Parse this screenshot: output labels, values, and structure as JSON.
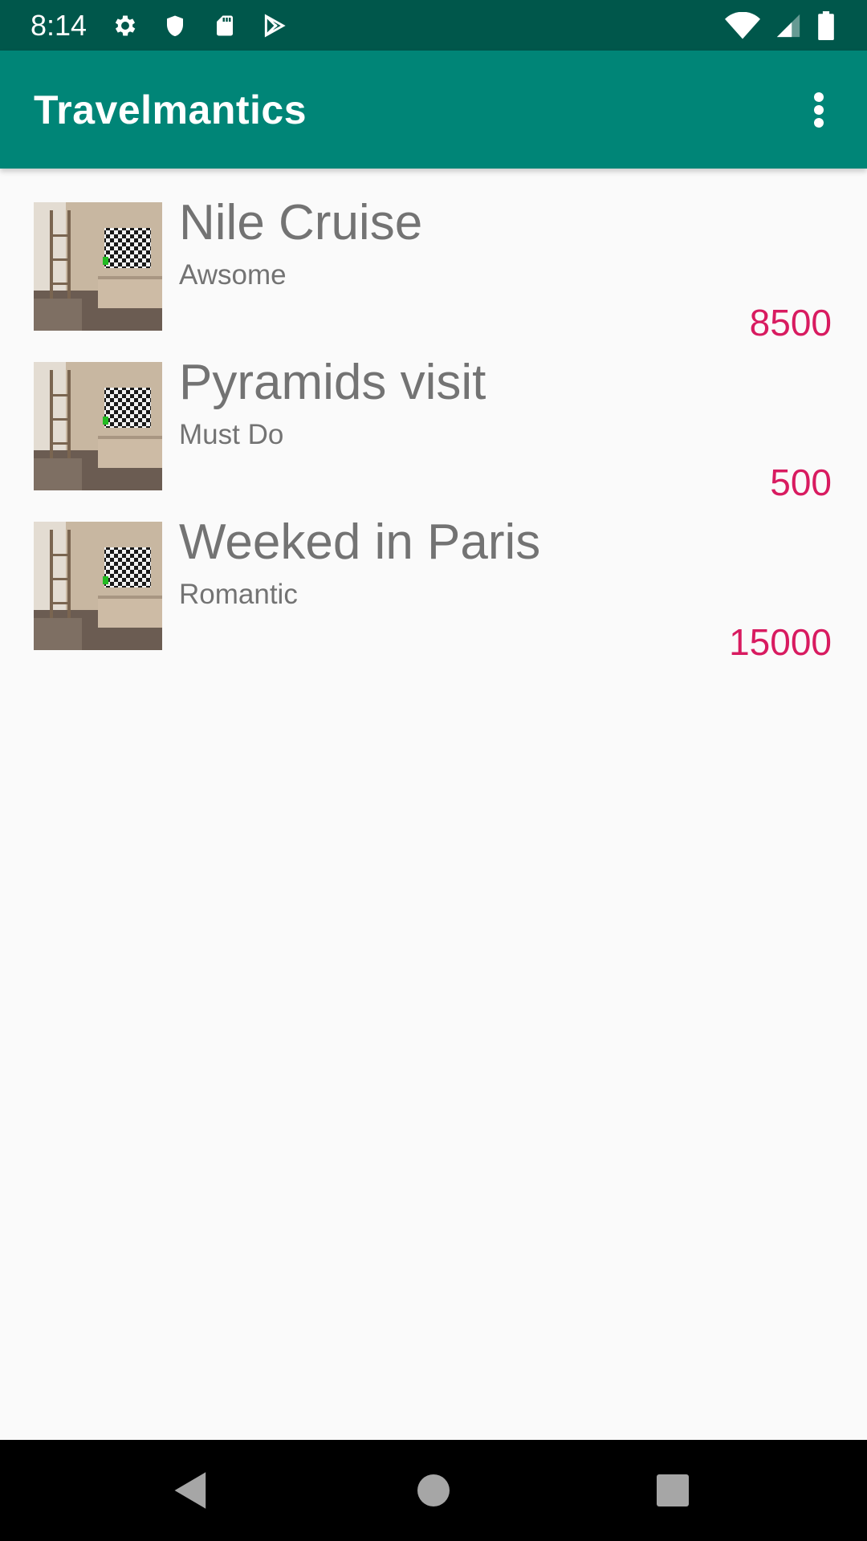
{
  "status_bar": {
    "time": "8:14",
    "left_icons": [
      "gear-icon",
      "shield-icon",
      "sd-card-icon",
      "play-store-icon"
    ],
    "right_icons": [
      "wifi-icon",
      "signal-icon",
      "battery-icon"
    ]
  },
  "app_bar": {
    "title": "Travelmantics",
    "menu_icon": "more-vert-icon"
  },
  "deals": [
    {
      "title": "Nile Cruise",
      "description": "Awsome",
      "price": "8500"
    },
    {
      "title": "Pyramids visit",
      "description": "Must Do",
      "price": "500"
    },
    {
      "title": "Weeked in Paris",
      "description": "Romantic",
      "price": "15000"
    }
  ],
  "nav_bar": {
    "buttons": [
      "back-icon",
      "home-icon",
      "recents-icon"
    ]
  },
  "colors": {
    "status_bar": "#00574b",
    "app_bar": "#008577",
    "accent": "#d81b60",
    "text": "#737373",
    "background": "#fafafa"
  }
}
